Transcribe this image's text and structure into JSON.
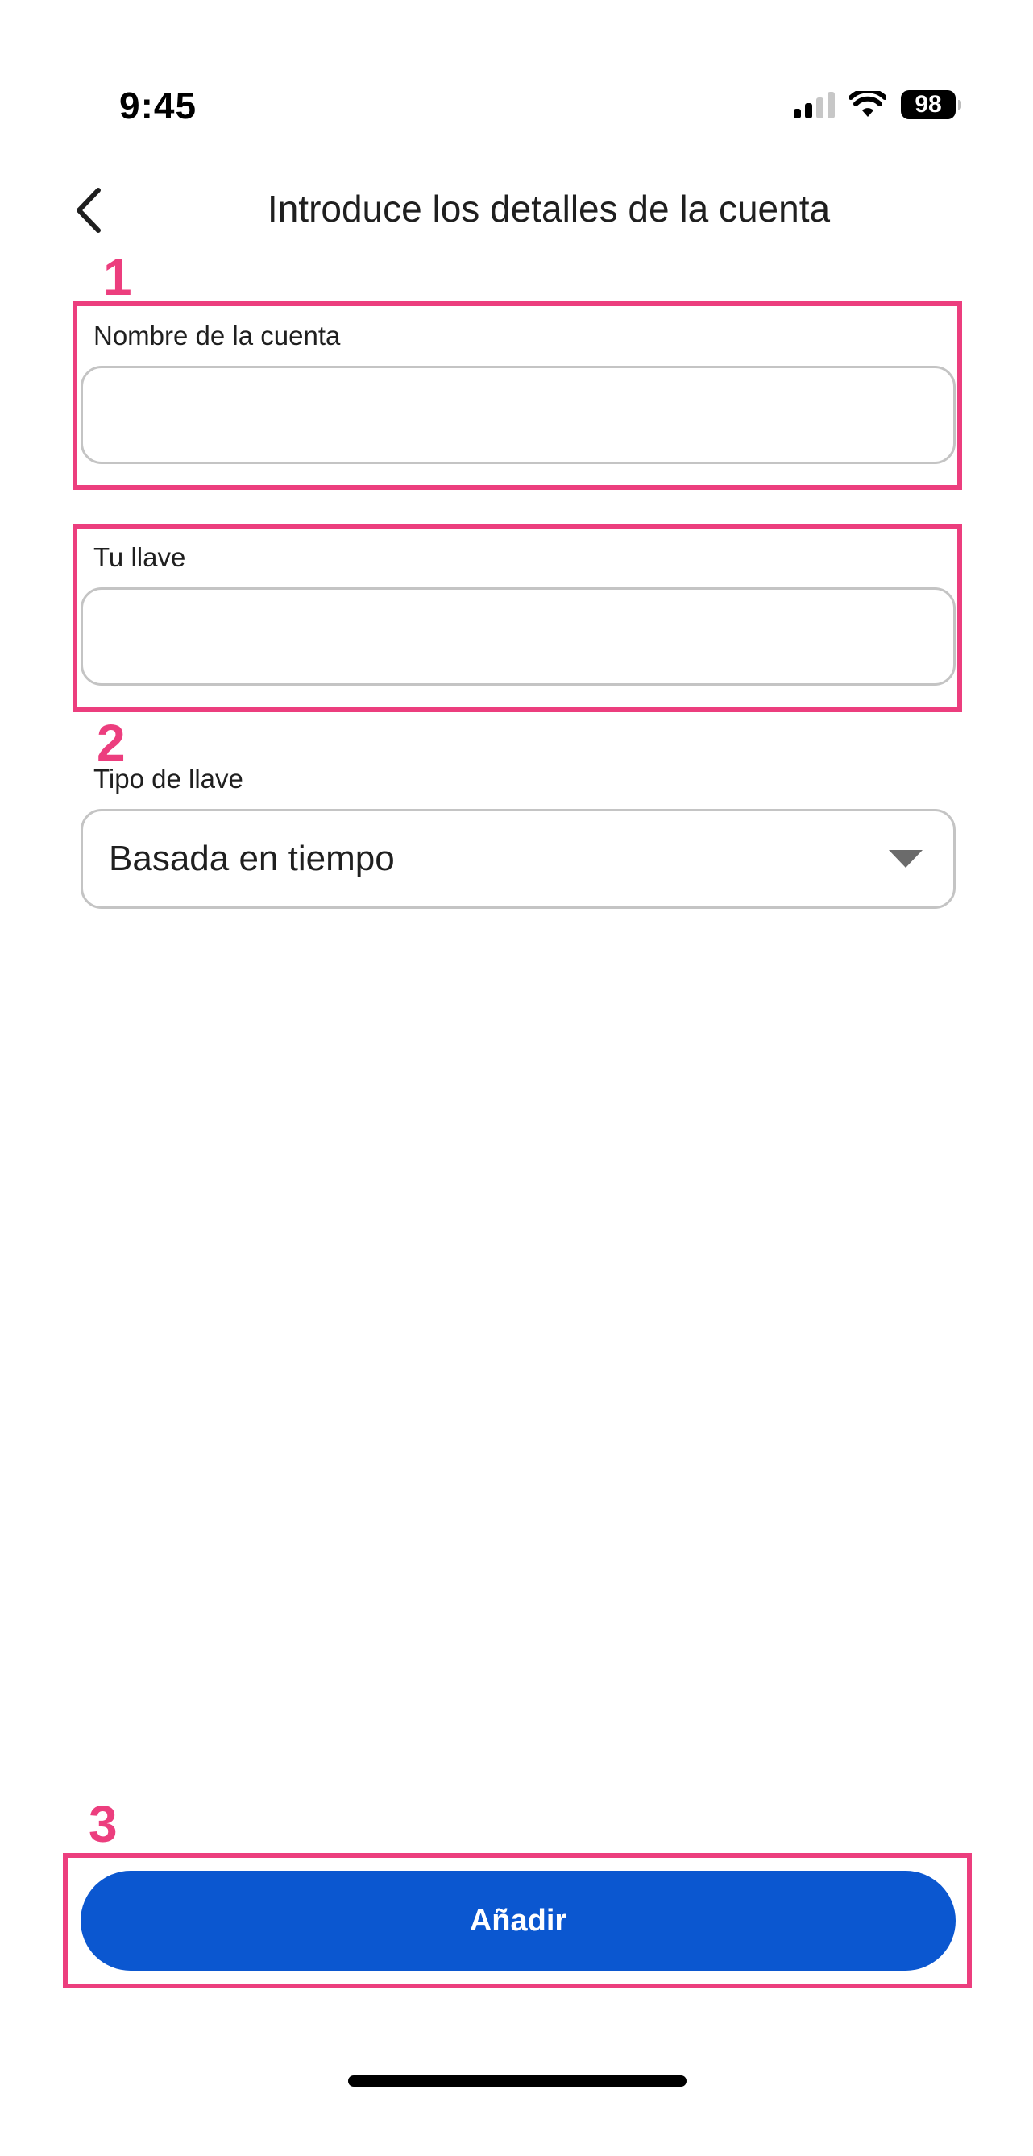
{
  "status_bar": {
    "time": "9:45",
    "battery": "98",
    "icons": [
      "cellular-signal-icon",
      "wifi-icon",
      "battery-icon"
    ]
  },
  "header": {
    "title": "Introduce los detalles de la cuenta",
    "back_icon": "chevron-left-icon"
  },
  "form": {
    "account_name": {
      "label": "Nombre de la cuenta",
      "value": ""
    },
    "key": {
      "label": "Tu llave",
      "value": ""
    },
    "key_type": {
      "label": "Tipo de llave",
      "selected": "Basada en tiempo",
      "icon": "dropdown-arrow-icon"
    }
  },
  "actions": {
    "add_label": "Añadir"
  },
  "annotations": {
    "step_1": "1",
    "step_2": "2",
    "step_3": "3"
  },
  "colors": {
    "primary": "#0b57d0",
    "annotation": "#ec3e7e",
    "field_border": "#c4c4c4",
    "text": "#1f1f1f"
  }
}
